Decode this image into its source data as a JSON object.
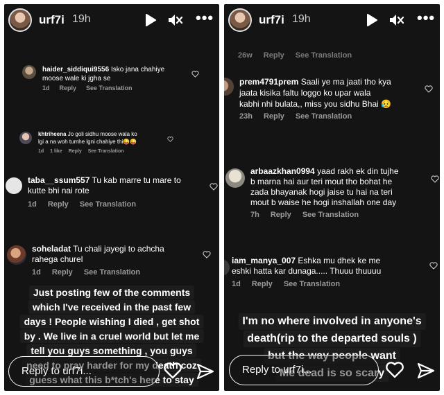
{
  "left": {
    "header": {
      "username": "urf7i",
      "time": "19h"
    },
    "comments": [
      {
        "user": "haider_siddiqui9556",
        "lines": [
          "Isko jana chahiye",
          "moose wale ki jgha se"
        ],
        "meta": [
          "1d",
          "Reply",
          "See Translation"
        ]
      },
      {
        "user": "khtriheena",
        "lines": [
          "Jo goli sidhu moose wala ko",
          "lgi a na woh tumhe lgni chahiye thi😜😜"
        ],
        "meta": [
          "1d",
          "1 like",
          "Reply",
          "See Translation"
        ]
      },
      {
        "user": "taba__ssum557",
        "lines": [
          "Tu kab marre tu mare to",
          "kutte bhi nai rote"
        ],
        "meta": [
          "1d",
          "Reply",
          "See Translation"
        ]
      },
      {
        "user": "soheladat",
        "lines": [
          "Tu chali jayegi to achcha",
          "rahega churel"
        ],
        "meta": [
          "1d",
          "Reply",
          "See Translation"
        ]
      }
    ],
    "caption": [
      "Just posting few of the comments",
      "which I've received in the past few",
      "days ! People wishing I died , get shot",
      "by . We live in a cruel world but let me",
      "tell you guys something , you guys",
      "need to pray harder for my death coz",
      "guess what this b*tch's here to stay"
    ],
    "reply_placeholder": "Reply to urf7i..."
  },
  "right": {
    "header": {
      "username": "urf7i",
      "time": "19h"
    },
    "partial_meta": [
      "26w",
      "Reply",
      "See Translation"
    ],
    "comments": [
      {
        "user": "prem4791prem",
        "lines": [
          "Saali ye ma jaati tho kya",
          "jaata kisika faltu loggo ko upar wala",
          "kabhi nhi bulata,, miss you sidhu Bhai 😥"
        ],
        "meta": [
          "23h",
          "Reply",
          "See Translation"
        ]
      },
      {
        "user": "arbaazkhan0994",
        "lines": [
          "yaad rakh ek din tujhe",
          "b marna hai aur teri mout tho bohat he",
          "zada bhayanak hogi jaise tu hai na teri",
          "mout b waise he hogi inshallah one day"
        ],
        "meta": [
          "7h",
          "Reply",
          "See Translation"
        ]
      },
      {
        "user": "iam_manya_007",
        "lines": [
          "Eshka mu dhek ke me",
          "eshki hatta kar dunaga..... Thuuu thuuuu"
        ],
        "meta": [
          "1d",
          "Reply",
          "See Translation"
        ]
      }
    ],
    "caption": [
      "I'm no where involved in anyone's",
      "death(rip to the departed souls )",
      "but the way people want",
      "Me dead is so scary"
    ],
    "reply_placeholder": "Reply to urf7i..."
  },
  "icons": {
    "play": "play-icon",
    "mute": "speaker-muted-icon",
    "more": "more-options-icon",
    "heart": "heart-icon",
    "send": "paper-plane-icon"
  }
}
